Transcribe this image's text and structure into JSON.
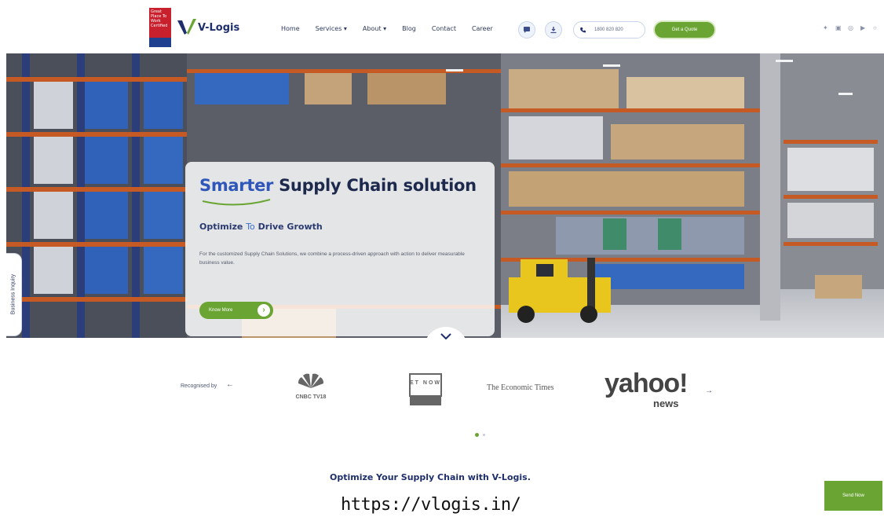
{
  "header": {
    "badge_text": "Great Place To Work Certified",
    "logo_text": "V-Logis",
    "nav": [
      "Home",
      "Services ▾",
      "About ▾",
      "Blog",
      "Contact",
      "Career"
    ],
    "phone": "1800 820 820",
    "quote_label": "Get a Quote",
    "accent_color": "#6aa534",
    "brand_color": "#1e2f6b"
  },
  "hero": {
    "title_highlight": "Smarter",
    "title_rest": "Supply Chain solution",
    "subtitle_a": "Optimize",
    "subtitle_b": "To",
    "subtitle_c": "Drive Growth",
    "description": "For the customized Supply Chain Solutions, we combine a process-driven approach with action to deliver measurable business value.",
    "cta_label": "Know More"
  },
  "side_tab": {
    "label": "Business Inquiry"
  },
  "recognized": {
    "label": "Recognised by",
    "logos": {
      "cnbc": "CNBC TV18",
      "et": "ET NOW",
      "economic_times": "The Economic Times",
      "yahoo": "yahoo!",
      "yahoo_sub": "news"
    }
  },
  "section": {
    "title": "Optimize Your Supply Chain with V-Logis."
  },
  "caption": {
    "url": "https://vlogis.in/"
  },
  "send_button": {
    "label": "Send Now"
  }
}
